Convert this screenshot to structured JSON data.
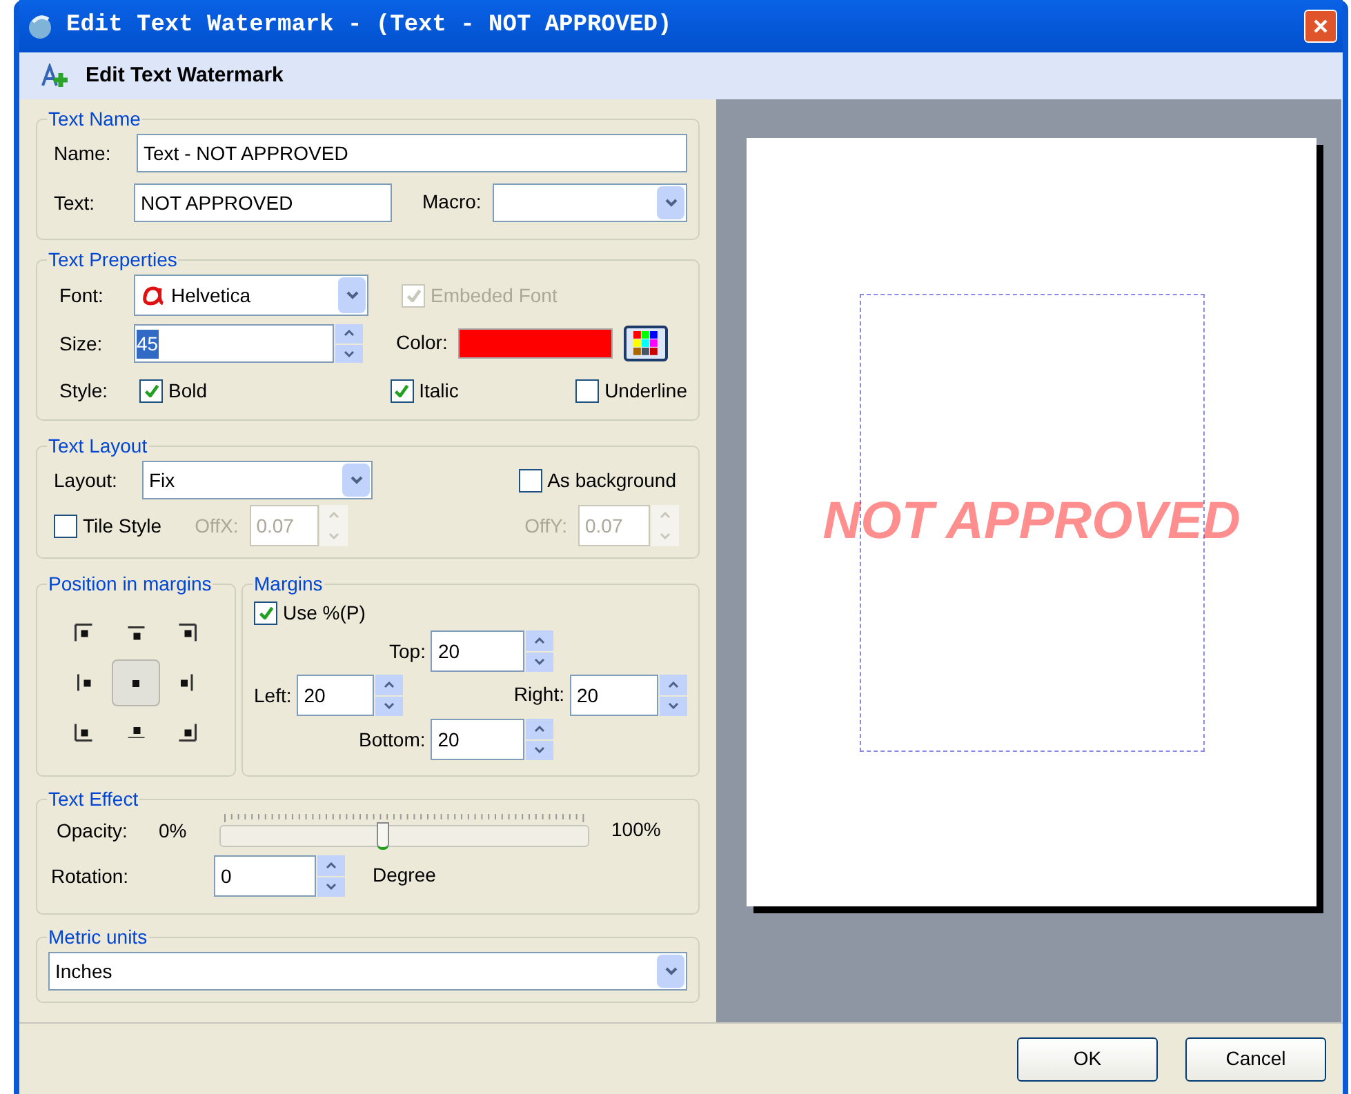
{
  "window": {
    "title": "Edit Text Watermark - (Text - NOT APPROVED)"
  },
  "header": {
    "title": "Edit Text Watermark"
  },
  "text_name": {
    "legend": "Text Name",
    "name_label": "Name:",
    "name_value": "Text - NOT APPROVED",
    "text_label": "Text:",
    "text_value": "NOT APPROVED",
    "macro_label": "Macro:"
  },
  "text_properties": {
    "legend": "Text Preperties",
    "font_label": "Font:",
    "font_value": "Helvetica",
    "embedded_font": {
      "label": "Embeded Font",
      "checked": true,
      "disabled": true
    },
    "size_label": "Size:",
    "size_value": "45",
    "color_label": "Color:",
    "color": "#ff0000",
    "style_label": "Style:",
    "styles": [
      {
        "label": "Bold",
        "checked": true
      },
      {
        "label": "Italic",
        "checked": true
      },
      {
        "label": "Underline",
        "checked": false
      }
    ]
  },
  "text_layout": {
    "legend": "Text Layout",
    "layout_label": "Layout:",
    "layout_value": "Fix",
    "as_background": {
      "label": "As background",
      "checked": false
    },
    "tile_style": {
      "label": "Tile Style",
      "checked": false
    },
    "offx": {
      "label": "OffX:",
      "value": "0.07",
      "disabled": true
    },
    "offy": {
      "label": "OffY:",
      "value": "0.07",
      "disabled": true
    }
  },
  "position": {
    "legend": "Position in margins",
    "cells": [
      {
        "selected": false
      },
      {
        "selected": false
      },
      {
        "selected": false
      },
      {
        "selected": false
      },
      {
        "selected": true
      },
      {
        "selected": false
      },
      {
        "selected": false
      },
      {
        "selected": false
      },
      {
        "selected": false
      }
    ]
  },
  "margins": {
    "legend": "Margins",
    "use_percent": {
      "label": "Use %(P)",
      "checked": true
    },
    "top": {
      "label": "Top:",
      "value": "20"
    },
    "left": {
      "label": "Left:",
      "value": "20"
    },
    "right": {
      "label": "Right:",
      "value": "20"
    },
    "bottom": {
      "label": "Bottom:",
      "value": "20"
    }
  },
  "text_effect": {
    "legend": "Text Effect",
    "opacity_label": "Opacity:",
    "opacity_min": "0%",
    "opacity_max": "100%",
    "level": 0.44,
    "rotation_label": "Rotation:",
    "rotation_value": "0",
    "rotation_unit": "Degree"
  },
  "metric_units": {
    "legend": "Metric units",
    "value": "Inches"
  },
  "preview": {
    "watermark_text": "NOT APPROVED"
  },
  "buttons": [
    "OK",
    "Cancel"
  ]
}
